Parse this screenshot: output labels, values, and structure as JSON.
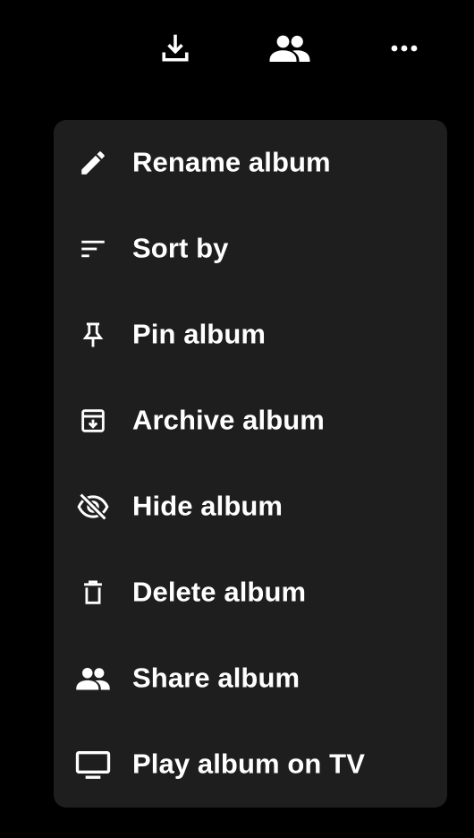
{
  "toolbar": {
    "icons": [
      "download-icon",
      "people-icon",
      "more-horizontal-icon"
    ]
  },
  "menu": {
    "items": [
      {
        "label": "Rename album",
        "icon": "pencil-icon"
      },
      {
        "label": "Sort by",
        "icon": "sort-icon"
      },
      {
        "label": "Pin album",
        "icon": "pin-icon"
      },
      {
        "label": "Archive album",
        "icon": "archive-icon"
      },
      {
        "label": "Hide album",
        "icon": "eye-off-icon"
      },
      {
        "label": "Delete album",
        "icon": "trash-icon"
      },
      {
        "label": "Share album",
        "icon": "people-icon"
      },
      {
        "label": "Play album on TV",
        "icon": "tv-icon"
      }
    ]
  },
  "colors": {
    "background": "#000000",
    "menu_background": "#1e1e1e",
    "text": "#ffffff"
  }
}
